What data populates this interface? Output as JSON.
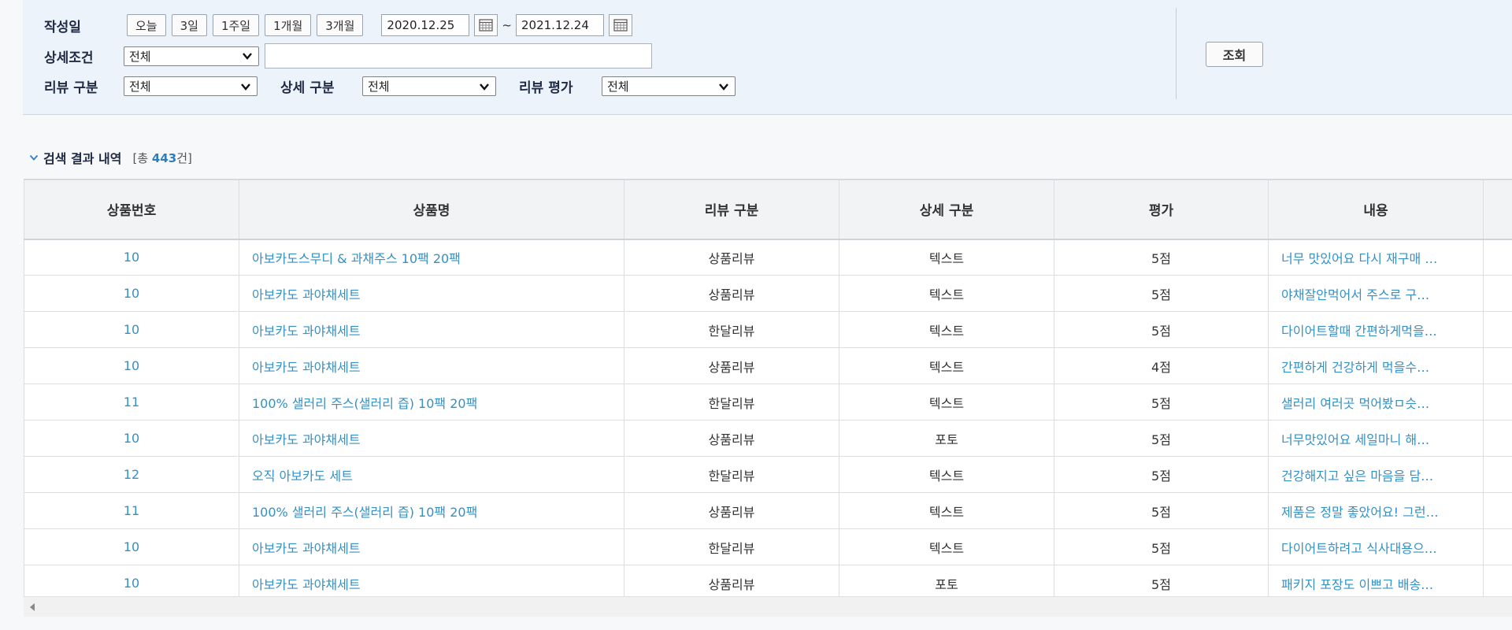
{
  "filters": {
    "date_label": "작성일",
    "quick_ranges": [
      "오늘",
      "3일",
      "1주일",
      "1개월",
      "3개월"
    ],
    "date_from": "2020.12.25",
    "date_sep": "~",
    "date_to": "2021.12.24",
    "detail_label": "상세조건",
    "detail_value": "전체",
    "detail_text": "",
    "review_type_label": "리뷰 구분",
    "review_type_value": "전체",
    "detail_type_label": "상세 구분",
    "detail_type_value": "전체",
    "rating_label": "리뷰 평가",
    "rating_value": "전체",
    "search_button": "조회"
  },
  "summary": {
    "title": "검색 결과 내역",
    "prefix": "[총 ",
    "count": "443",
    "suffix": "건]"
  },
  "table": {
    "columns": [
      "상품번호",
      "상품명",
      "리뷰 구분",
      "상세 구분",
      "평가",
      "내용",
      ""
    ],
    "rows": [
      [
        "10",
        "아보카도스무디 & 과채주스 10팩 20팩",
        "상품리뷰",
        "텍스트",
        "5점",
        "너무 맛있어요 다시 재구매 …"
      ],
      [
        "10",
        "아보카도 과야채세트",
        "상품리뷰",
        "텍스트",
        "5점",
        "야채잘안먹어서 주스로 구…"
      ],
      [
        "10",
        "아보카도 과야채세트",
        "한달리뷰",
        "텍스트",
        "5점",
        "다이어트할때 간편하게먹을…"
      ],
      [
        "10",
        "아보카도 과야채세트",
        "상품리뷰",
        "텍스트",
        "4점",
        "간편하게 건강하게 먹을수…"
      ],
      [
        "11",
        "100% 샐러리 주스(샐러리 즙) 10팩 20팩",
        "한달리뷰",
        "텍스트",
        "5점",
        "샐러리 여러곳 먹어봤ㅁ슷…"
      ],
      [
        "10",
        "아보카도 과야채세트",
        "상품리뷰",
        "포토",
        "5점",
        "너무맛있어요 세일마니 해…"
      ],
      [
        "12",
        "오직 아보카도 세트",
        "한달리뷰",
        "텍스트",
        "5점",
        "건강해지고 싶은 마음을 담…"
      ],
      [
        "11",
        "100% 샐러리 주스(샐러리 즙) 10팩 20팩",
        "상품리뷰",
        "텍스트",
        "5점",
        "제품은 정말 좋았어요! 그런…"
      ],
      [
        "10",
        "아보카도 과야채세트",
        "한달리뷰",
        "텍스트",
        "5점",
        "다이어트하려고 식사대용으…"
      ],
      [
        "10",
        "아보카도 과야채세트",
        "상품리뷰",
        "포토",
        "5점",
        "패키지 포장도 이쁘고 배송…"
      ]
    ]
  }
}
